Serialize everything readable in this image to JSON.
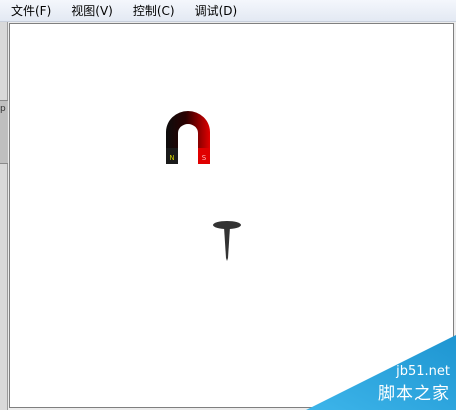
{
  "menu": {
    "items": [
      "文件(F)",
      "视图(V)",
      "控制(C)",
      "调试(D)"
    ]
  },
  "side_strip": {
    "glyph": "p"
  },
  "stage": {
    "sprites": [
      {
        "name": "magnet",
        "pole_labels": [
          "N",
          "S"
        ]
      },
      {
        "name": "nail"
      }
    ]
  },
  "watermark": {
    "url": "jb51.net",
    "site_name": "脚本之家"
  },
  "colors": {
    "menubar": "#e7ecf5",
    "stage_bg": "#ffffff",
    "magnet_dark": "#111111",
    "magnet_red": "#d40000",
    "nail": "#333333",
    "watermark": "#29a8e0"
  }
}
